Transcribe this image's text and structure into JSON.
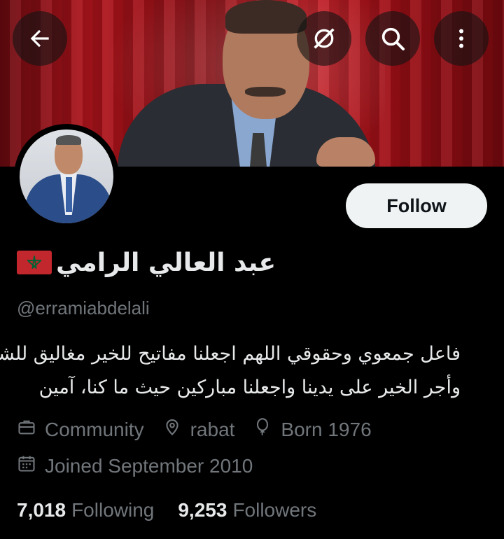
{
  "header": {
    "back_icon": "arrow-left-icon",
    "grok_icon": "grok-icon",
    "search_icon": "search-icon",
    "more_icon": "more-vertical-icon"
  },
  "profile": {
    "display_name": "عبد العالي الرامي",
    "flag": "morocco-flag",
    "handle": "@erramiabdelali",
    "follow_label": "Follow",
    "bio_lines": [
      "فاعل جمعوي وحقوقي اللهم اجعلنا مفاتيح للخير مغاليق للشر",
      "وأجر الخير على يدينا واجعلنا مباركين حيث ما كنا، آمين"
    ],
    "category": "Community",
    "location": "rabat",
    "born": "Born 1976",
    "joined": "Joined September 2010",
    "following_count": "7,018",
    "following_label": "Following",
    "followers_count": "9,253",
    "followers_label": "Followers"
  },
  "colors": {
    "background": "#000000",
    "text_primary": "#e7e9ea",
    "text_secondary": "#71767b",
    "follow_bg": "#eff3f4",
    "flag_red": "#c1272d",
    "flag_green": "#006233"
  }
}
